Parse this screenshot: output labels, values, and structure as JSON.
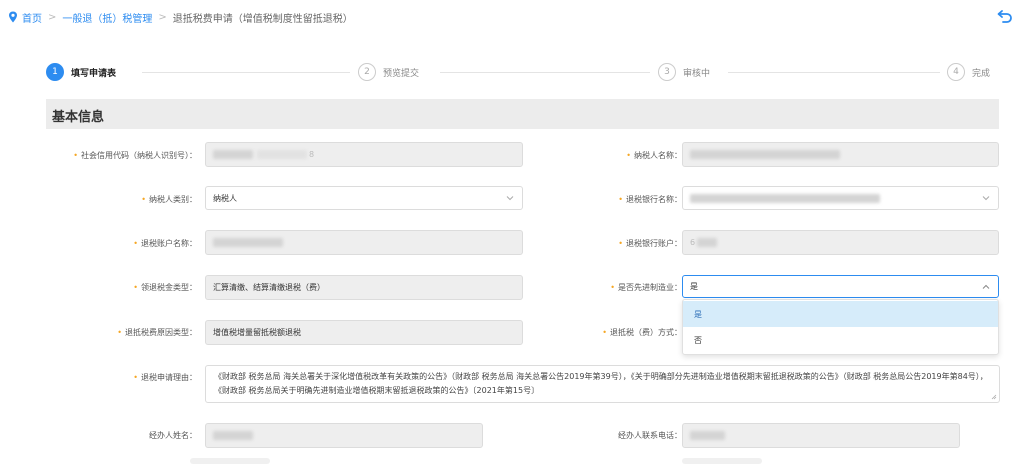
{
  "breadcrumb": {
    "home": "首页",
    "level2": "一般退（抵）税管理",
    "current": "退抵税费申请（增值税制度性留抵退税）"
  },
  "steps": [
    {
      "number": "1",
      "label": "填写申请表",
      "active": true
    },
    {
      "number": "2",
      "label": "预览提交",
      "active": false
    },
    {
      "number": "3",
      "label": "审核中",
      "active": false
    },
    {
      "number": "4",
      "label": "完成",
      "active": false
    }
  ],
  "section_title": "基本信息",
  "form": {
    "credit_code": {
      "label": "社会信用代码（纳税人识别号）：",
      "value": "8"
    },
    "taxpayer_name": {
      "label": "纳税人名称："
    },
    "taxpayer_type": {
      "label": "纳税人类别：",
      "value": "纳税人"
    },
    "bank_name": {
      "label": "退税银行名称："
    },
    "account_name": {
      "label": "退税账户名称："
    },
    "bank_account": {
      "label": "退税银行账户：",
      "value": "6"
    },
    "refund_type": {
      "label": "领退税金类型：",
      "value": "汇算清缴、结算清缴退税（费）"
    },
    "advanced_manufacturing": {
      "label": "是否先进制造业：",
      "value": "是",
      "options": [
        "是",
        "否"
      ],
      "highlighted": "是"
    },
    "refund_reason_type": {
      "label": "退抵税费原因类型：",
      "value": "增值税增量留抵税额退税"
    },
    "refund_method": {
      "label": "退抵税（费）方式："
    },
    "refund_reason": {
      "label": "退税申请理由：",
      "value": "《财政部 税务总局 海关总署关于深化增值税改革有关政策的公告》（财政部 税务总局 海关总署公告2019年第39号），《关于明确部分先进制造业增值税期末留抵退税政策的公告》（财政部 税务总局公告2019年第84号），《财政部 税务总局关于明确先进制造业增值税期末留抵退税政策的公告》〔2021年第15号〕"
    },
    "agent_name": {
      "label": "经办人姓名："
    },
    "agent_phone": {
      "label": "经办人联系电话："
    }
  },
  "colors": {
    "accent": "#2d8cf0",
    "required": "#f5a623",
    "section_bg": "#ececec"
  }
}
